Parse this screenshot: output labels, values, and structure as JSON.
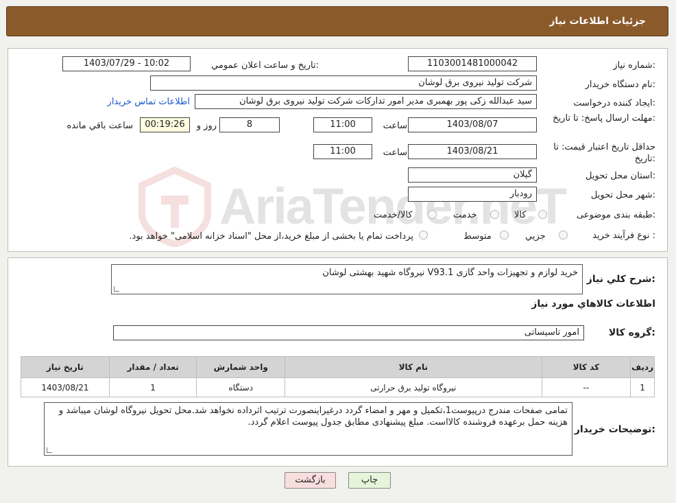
{
  "header": {
    "title": "جزئيات اطلاعات نياز"
  },
  "labels": {
    "need_number": "شماره نياز:",
    "announce_datetime": "تاريخ و ساعت اعلان عمومي:",
    "buyer_org": "نام دستگاه خريدار:",
    "requester": "ايجاد کننده درخواست:",
    "reply_deadline": "مهلت ارسال پاسخ: تا تاريخ:",
    "time": "ساعت",
    "days": "روز و",
    "remaining": "ساعت باقي مانده",
    "price_validity": "حداقل تاريخ اعتبار قيمت: تا تاريخ:",
    "time2": "ساعت",
    "province": "استان محل تحويل:",
    "city": "شهر محل تحويل:",
    "category": "طبقه بندی موضوعی:",
    "process": "نوع فرآيند خريد :"
  },
  "values": {
    "need_number": "1103001481000042",
    "announce_datetime": "1403/07/29 - 10:02",
    "buyer_org": "شرکت تولید نیروی برق لوشان",
    "requester": "سید عبدالله زکی پور بهمبری مدیر امور تدارکات شرکت تولید نیروی برق لوشان",
    "buyer_contact_link": "اطلاعات تماس خريدار",
    "reply_date": "1403/08/07",
    "reply_time": "11:00",
    "days_left": "8",
    "time_left": "00:19:26",
    "price_date": "1403/08/21",
    "price_time": "11:00",
    "province": "گیلان",
    "city": "رودبار"
  },
  "category_options": [
    {
      "label": "کالا",
      "selected": false
    },
    {
      "label": "خدمت",
      "selected": false
    },
    {
      "label": "کالا/خدمت",
      "selected": false
    }
  ],
  "process_options": [
    {
      "label": "جزيي",
      "selected": false
    },
    {
      "label": "متوسط",
      "selected": false
    }
  ],
  "process_note": "پرداخت تمام یا بخشی از مبلغ خرید،از محل \"اسناد خزانه اسلامی\" خواهد بود.",
  "summary": {
    "label": "شرح کلي نياز:",
    "text": "خرید لوازم و تجهیزات واحد گازی V93.1 نیروگاه شهید بهشتی لوشان"
  },
  "goods": {
    "section_title": "اطلاعات کالاهاي مورد نياز",
    "group_label": "گروه کالا:",
    "group_value": "امور تاسیساتی",
    "columns": [
      "رديف",
      "کد کالا",
      "نام کالا",
      "واحد شمارش",
      "تعداد / مقدار",
      "تاريخ نياز"
    ],
    "rows": [
      [
        "1",
        "--",
        "نیروگاه تولید برق حرارتی",
        "دستگاه",
        "1",
        "1403/08/21"
      ]
    ]
  },
  "buyer_notes": {
    "label": "توضيحات خريدار:",
    "text": "تمامی صفحات مندرج درپیوست1،تکمیل و مهر و امضاء گردد درغیراینصورت ترتیب اثرداده نخواهد شد.محل تحویل نیروگاه لوشان میباشد و هزینه حمل برعهده فروشنده کالااست. مبلغ پیشنهادی مطابق جدول پیوست اعلام گردد."
  },
  "buttons": {
    "print": "چاپ",
    "back": "بازگشت"
  },
  "watermark": {
    "text": "AriaTender.neT"
  },
  "colors": {
    "header_bg": "#8b5a2b",
    "link": "#1a57c9",
    "print_button": "#e6f4dc",
    "back_button": "#f9dede"
  }
}
